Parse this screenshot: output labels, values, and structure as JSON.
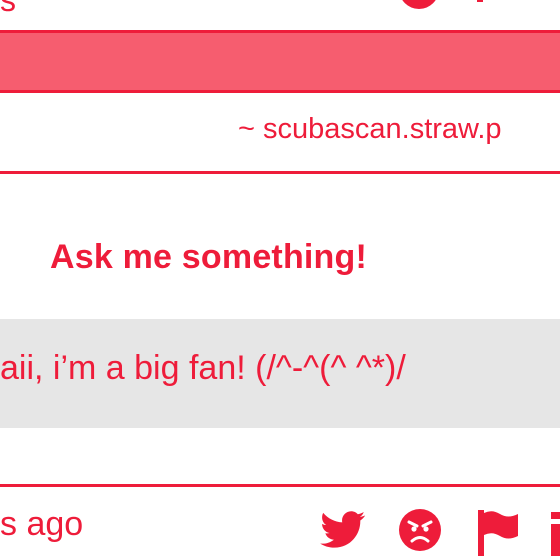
{
  "previous_post": {
    "time_fragment": "s"
  },
  "profile": {
    "handle": "~ scubascan.straw.p"
  },
  "ask_box": {
    "heading": "Ask me something!"
  },
  "question": {
    "text": "aii, i’m a big fan! (/^-^(^ ^*)/"
  },
  "footer": {
    "time_ago": "s ago",
    "icons": [
      "twitter-icon",
      "angry-face-icon",
      "flag-icon",
      "info-icon"
    ]
  },
  "colors": {
    "accent": "#ee1c3a",
    "banner": "#f65d6f",
    "question_bg": "#e6e6e6",
    "background": "#ffffff"
  }
}
